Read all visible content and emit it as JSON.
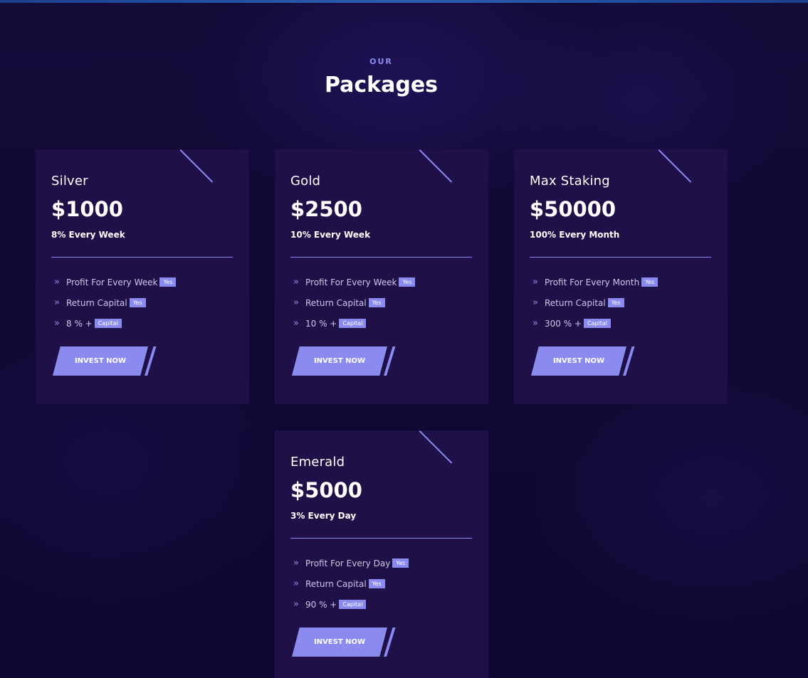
{
  "header": {
    "eyebrow": "OUR",
    "title": "Packages"
  },
  "packages": [
    {
      "name": "Silver",
      "price": "$1000",
      "rate": "8% Every Week",
      "features": [
        {
          "text": "Profit For Every Week",
          "badge": "Yes"
        },
        {
          "text": "Return Capital",
          "badge": "Yes"
        },
        {
          "text": "8 % +",
          "badge": "Capital"
        }
      ],
      "button": "INVEST NOW"
    },
    {
      "name": "Gold",
      "price": "$2500",
      "rate": "10% Every Week",
      "features": [
        {
          "text": "Profit For Every Week",
          "badge": "Yes"
        },
        {
          "text": "Return Capital",
          "badge": "Yes"
        },
        {
          "text": "10 % +",
          "badge": "Capital"
        }
      ],
      "button": "INVEST NOW"
    },
    {
      "name": "Max Staking",
      "price": "$50000",
      "rate": "100% Every Month",
      "features": [
        {
          "text": "Profit For Every Month",
          "badge": "Yes"
        },
        {
          "text": "Return Capital",
          "badge": "Yes"
        },
        {
          "text": "300 % +",
          "badge": "Capital"
        }
      ],
      "button": "INVEST NOW"
    },
    {
      "name": "Emerald",
      "price": "$5000",
      "rate": "3% Every Day",
      "features": [
        {
          "text": "Profit For Every Day",
          "badge": "Yes"
        },
        {
          "text": "Return Capital",
          "badge": "Yes"
        },
        {
          "text": "90 % +",
          "badge": "Capital"
        }
      ],
      "button": "INVEST NOW"
    }
  ],
  "icons": {
    "feature_bullet": "double-chevron-right-icon"
  },
  "colors": {
    "background": "#120a35",
    "card": "#1f1048",
    "accent": "#8b8bef"
  }
}
